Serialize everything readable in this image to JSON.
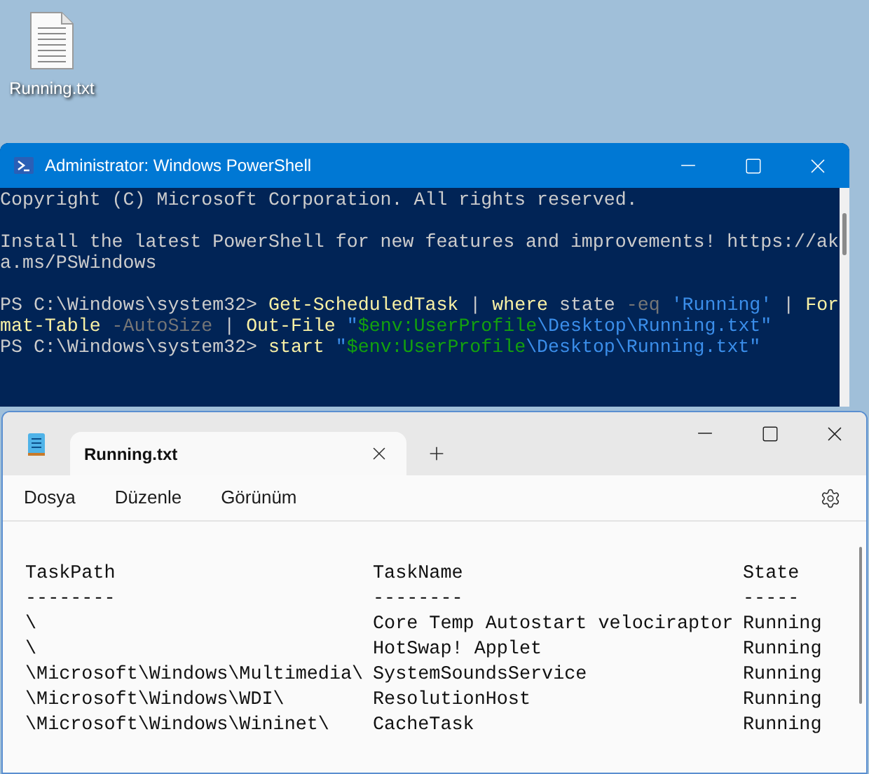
{
  "desktop_icon": {
    "label": "Running.txt"
  },
  "powershell": {
    "title": "Administrator: Windows PowerShell",
    "paragraphs": [
      {
        "lines": [
          {
            "segments": [
              {
                "kind": "text",
                "text": "Copyright (C) Microsoft Corporation. All rights reserved."
              }
            ]
          }
        ]
      },
      {
        "lines": [
          {
            "segments": [
              {
                "kind": "text",
                "text": "Install the latest PowerShell for new features and improvements! https://ak"
              }
            ]
          },
          {
            "segments": [
              {
                "kind": "text",
                "text": "a.ms/PSWindows"
              }
            ]
          }
        ]
      },
      {
        "lines": [
          {
            "segments": [
              {
                "kind": "text",
                "text": "PS C:\\Windows\\system32> "
              },
              {
                "kind": "command",
                "text": "Get-ScheduledTask"
              },
              {
                "kind": "text",
                "text": " | "
              },
              {
                "kind": "command",
                "text": "where"
              },
              {
                "kind": "text",
                "text": " state "
              },
              {
                "kind": "param",
                "text": "-eq "
              },
              {
                "kind": "string",
                "text": "'Running'"
              },
              {
                "kind": "text",
                "text": " | "
              },
              {
                "kind": "command",
                "text": "For"
              }
            ]
          },
          {
            "segments": [
              {
                "kind": "command",
                "text": "mat-Table "
              },
              {
                "kind": "param",
                "text": "-AutoSize"
              },
              {
                "kind": "text",
                "text": " | "
              },
              {
                "kind": "command",
                "text": "Out-File "
              },
              {
                "kind": "string",
                "text": "\""
              },
              {
                "kind": "variable",
                "text": "$env:UserProfile"
              },
              {
                "kind": "string",
                "text": "\\Desktop\\Running.txt\""
              }
            ]
          },
          {
            "segments": [
              {
                "kind": "text",
                "text": "PS C:\\Windows\\system32> "
              },
              {
                "kind": "command",
                "text": "start "
              },
              {
                "kind": "string",
                "text": "\""
              },
              {
                "kind": "variable",
                "text": "$env:UserProfile"
              },
              {
                "kind": "string",
                "text": "\\Desktop\\Running.txt\""
              }
            ]
          }
        ]
      }
    ]
  },
  "notepad": {
    "tabs": [
      {
        "label": "Running.txt",
        "selected": true
      }
    ],
    "menu": [
      "Dosya",
      "Düzenle",
      "Görünüm"
    ],
    "columns": [
      "TaskPath",
      "TaskName",
      "State"
    ],
    "dividers": [
      "--------",
      "--------",
      "-----"
    ],
    "rows": [
      [
        "\\",
        "Core Temp Autostart velociraptor",
        "Running"
      ],
      [
        "\\",
        "HotSwap! Applet",
        "Running"
      ],
      [
        "\\Microsoft\\Windows\\Multimedia\\",
        "SystemSoundsService",
        "Running"
      ],
      [
        "\\Microsoft\\Windows\\WDI\\",
        "ResolutionHost",
        "Running"
      ],
      [
        "\\Microsoft\\Windows\\Wininet\\",
        "CacheTask",
        "Running"
      ]
    ]
  }
}
